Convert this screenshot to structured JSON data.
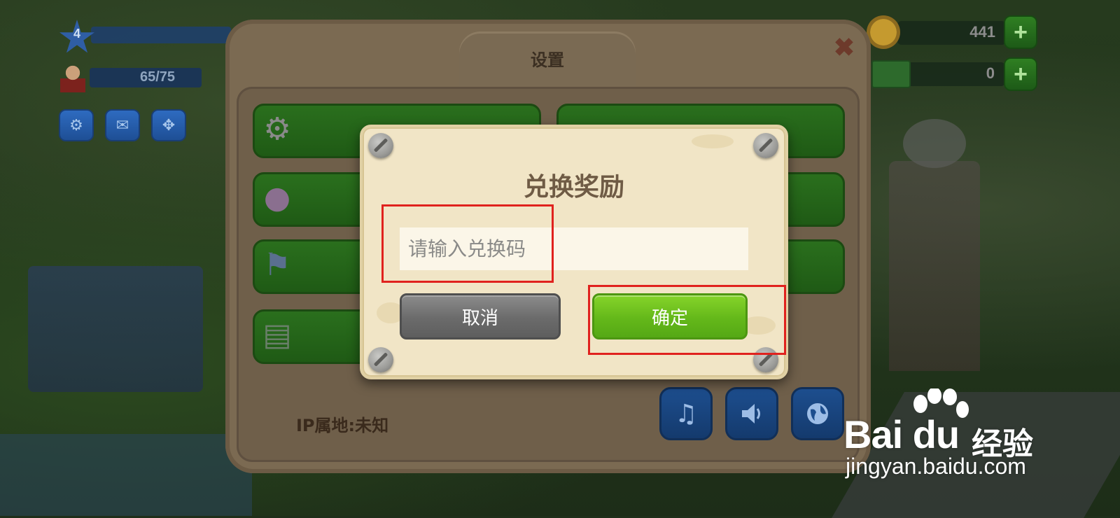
{
  "hud": {
    "level": "4",
    "population": "65/75",
    "coins": "441",
    "cash": "0",
    "plus_label": "+"
  },
  "settings": {
    "title": "设置",
    "close_label": "✖",
    "ip_location": "IP属地:未知"
  },
  "dialog": {
    "title": "兑换奖励",
    "code_placeholder": "请输入兑换码",
    "code_value": "",
    "cancel_label": "取消",
    "confirm_label": "确定"
  },
  "icons": {
    "gear": "gear-icon",
    "mail": "mail-icon",
    "move": "move-icon",
    "chat": "chat-bubble-icon",
    "flag": "checkered-flag-icon",
    "document": "document-icon",
    "music": "music-note-icon",
    "speaker": "speaker-icon",
    "globe": "globe-icon"
  },
  "colors": {
    "confirm_green": "#64b81a",
    "cancel_gray": "#6b6b6b",
    "dialog_parchment": "#f1e5c6",
    "highlight_red": "#e0221e",
    "menu_green": "#1f5a15"
  },
  "watermark": {
    "brand": "Bai du",
    "brand_cn": "经验",
    "url": "jingyan.baidu.com"
  }
}
